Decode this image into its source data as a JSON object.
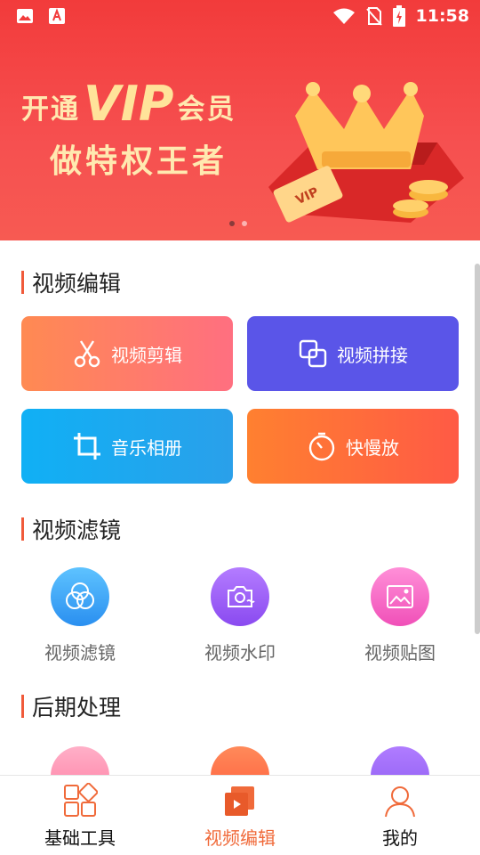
{
  "status_bar": {
    "time": "11:58"
  },
  "banner": {
    "line1_prefix": "开通",
    "vip_word": "VIP",
    "line1_suffix": "会员",
    "line2": "做特权王者",
    "card_text": "VIP"
  },
  "sections": {
    "video_edit": {
      "title": "视频编辑",
      "tiles": [
        {
          "label": "视频剪辑",
          "icon": "scissors-icon"
        },
        {
          "label": "视频拼接",
          "icon": "merge-squares-icon"
        },
        {
          "label": "音乐相册",
          "icon": "crop-icon"
        },
        {
          "label": "快慢放",
          "icon": "stopwatch-icon"
        }
      ]
    },
    "video_filter": {
      "title": "视频滤镜",
      "items": [
        {
          "label": "视频滤镜",
          "icon": "filter-circles-icon"
        },
        {
          "label": "视频水印",
          "icon": "camera-watermark-icon"
        },
        {
          "label": "视频贴图",
          "icon": "image-sticker-icon"
        }
      ]
    },
    "post_processing": {
      "title": "后期处理"
    }
  },
  "bottom_nav": [
    {
      "label": "基础工具",
      "icon": "grid-tools-icon",
      "active": false
    },
    {
      "label": "视频编辑",
      "icon": "video-edit-icon",
      "active": true
    },
    {
      "label": "我的",
      "icon": "user-profile-icon",
      "active": false
    }
  ],
  "colors": {
    "accent": "#f06a3a",
    "banner_red": "#f23b3b",
    "tile_cut": "#ff7a5c",
    "tile_merge": "#5a55e8",
    "tile_album": "#1aa8f0",
    "tile_speed": "#ff6a3a"
  }
}
